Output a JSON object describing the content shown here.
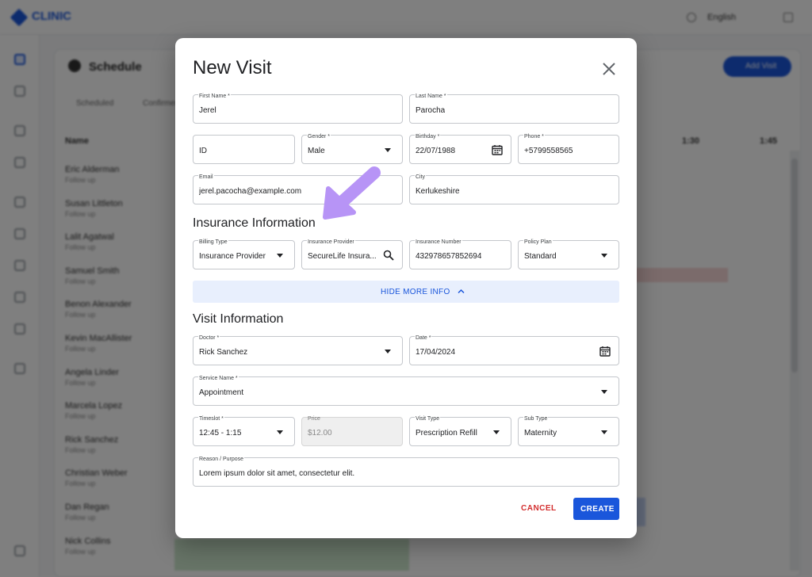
{
  "background": {
    "brand_color": "#1a56db",
    "logo_text": "CLINIC",
    "language": "English",
    "page_title": "Schedule",
    "header_button": "Add Visit",
    "chips": [
      "Scheduled",
      "Confirmed"
    ],
    "table_header": "Name",
    "columns": [
      "1:30",
      "1:45"
    ],
    "rows": [
      {
        "name": "Eric Alderman",
        "sub": "Follow up"
      },
      {
        "name": "Susan Littleton",
        "sub": "Follow up"
      },
      {
        "name": "Lalit Agatwal",
        "sub": "Follow up"
      },
      {
        "name": "Samuel Smith",
        "sub": "Follow up"
      },
      {
        "name": "Benon Alexander",
        "sub": "Follow up"
      },
      {
        "name": "Kevin MacAllister",
        "sub": "Follow up"
      },
      {
        "name": "Angela Linder",
        "sub": "Follow up"
      },
      {
        "name": "Marcela Lopez",
        "sub": "Follow up"
      },
      {
        "name": "Rick Sanchez",
        "sub": "Follow up"
      },
      {
        "name": "Christian Weber",
        "sub": "Follow up"
      },
      {
        "name": "Dan Regan",
        "sub": "Follow up"
      },
      {
        "name": "Nick Collins",
        "sub": "Follow up"
      }
    ]
  },
  "modal": {
    "title": "New Visit",
    "patient": {
      "first_name": {
        "label": "First Name *",
        "value": "Jerel"
      },
      "last_name": {
        "label": "Last Name *",
        "value": "Parocha"
      },
      "id": {
        "label": "",
        "value": "ID"
      },
      "gender": {
        "label": "Gender *",
        "value": "Male"
      },
      "birthday": {
        "label": "Birthday *",
        "value": "22/07/1988"
      },
      "phone": {
        "label": "Phone *",
        "value": "+5799558565"
      },
      "email": {
        "label": "Email",
        "value": "jerel.pacocha@example.com"
      },
      "city": {
        "label": "City",
        "value": "Kerlukeshire"
      }
    },
    "insurance_title": "Insurance Information",
    "insurance": {
      "billing_type": {
        "label": "Billing Type",
        "value": "Insurance Provider"
      },
      "provider": {
        "label": "Insurance Provider",
        "value": "SecureLife Insura..."
      },
      "number": {
        "label": "Insurance Number",
        "value": "432978657852694"
      },
      "policy_plan": {
        "label": "Policy Plan",
        "value": "Standard"
      }
    },
    "toggle_label": "HIDE MORE INFO",
    "visit_title": "Visit Information",
    "visit": {
      "doctor": {
        "label": "Doctor *",
        "value": "Rick Sanchez"
      },
      "date": {
        "label": "Date *",
        "value": "17/04/2024"
      },
      "service": {
        "label": "Service Name *",
        "value": "Appointment"
      },
      "timeslot": {
        "label": "Timeslot *",
        "value": "12:45 - 1:15"
      },
      "price": {
        "label": "Price",
        "value": "$12.00"
      },
      "visit_type": {
        "label": "Visit Type",
        "value": "Prescription Refill"
      },
      "sub_type": {
        "label": "Sub Type",
        "value": "Maternity"
      },
      "reason": {
        "label": "Reason / Purpose",
        "value": "Lorem ipsum dolor sit amet, consectetur elit."
      }
    },
    "cancel_label": "CANCEL",
    "create_label": "CREATE",
    "accent_color": "#1a56db",
    "danger_color": "#d32f2f",
    "annotation_color": "#b794f6"
  }
}
